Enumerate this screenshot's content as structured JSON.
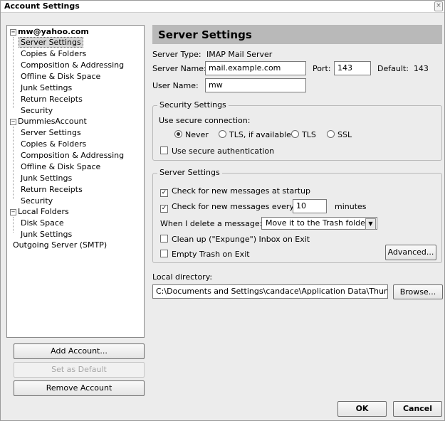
{
  "window": {
    "title": "Account Settings",
    "close_glyph": "×"
  },
  "tree": {
    "accounts": [
      {
        "name": "mw@yahoo.com",
        "items": [
          "Server Settings",
          "Copies & Folders",
          "Composition & Addressing",
          "Offline & Disk Space",
          "Junk Settings",
          "Return Receipts",
          "Security"
        ]
      },
      {
        "name": "DummiesAccount",
        "items": [
          "Server Settings",
          "Copies & Folders",
          "Composition & Addressing",
          "Offline & Disk Space",
          "Junk Settings",
          "Return Receipts",
          "Security"
        ]
      },
      {
        "name": "Local Folders",
        "items": [
          "Disk Space",
          "Junk Settings"
        ]
      }
    ],
    "outgoing": "Outgoing Server (SMTP)"
  },
  "buttons": {
    "add": "Add Account...",
    "default": "Set as Default",
    "remove": "Remove Account",
    "ok": "OK",
    "cancel": "Cancel",
    "advanced": "Advanced...",
    "browse": "Browse..."
  },
  "panel": {
    "header": "Server Settings",
    "server_type_label": "Server Type:",
    "server_type_value": "IMAP Mail Server",
    "server_name_label": "Server Name:",
    "server_name_value": "mail.example.com",
    "port_label": "Port:",
    "port_value": "143",
    "default_label": "Default:",
    "default_value": "143",
    "user_name_label": "User Name:",
    "user_name_value": "mw"
  },
  "security": {
    "legend": "Security Settings",
    "use_secure": "Use secure connection:",
    "options": [
      "Never",
      "TLS, if available",
      "TLS",
      "SSL"
    ],
    "selected": "Never",
    "secure_auth": "Use secure authentication",
    "secure_auth_checked": false
  },
  "server": {
    "legend": "Server Settings",
    "check_startup": "Check for new messages at startup",
    "check_startup_checked": true,
    "check_every": "Check for new messages every",
    "check_every_checked": true,
    "minutes_value": "10",
    "minutes_label": "minutes",
    "delete_label": "When I delete a message:",
    "delete_option": "Move it to the Trash folder",
    "cleanup": "Clean up (\"Expunge\") Inbox on Exit",
    "cleanup_checked": false,
    "empty_trash": "Empty Trash on Exit",
    "empty_trash_checked": false
  },
  "local": {
    "label": "Local directory:",
    "path": "C:\\Documents and Settings\\candace\\Application Data\\Thunderb"
  }
}
